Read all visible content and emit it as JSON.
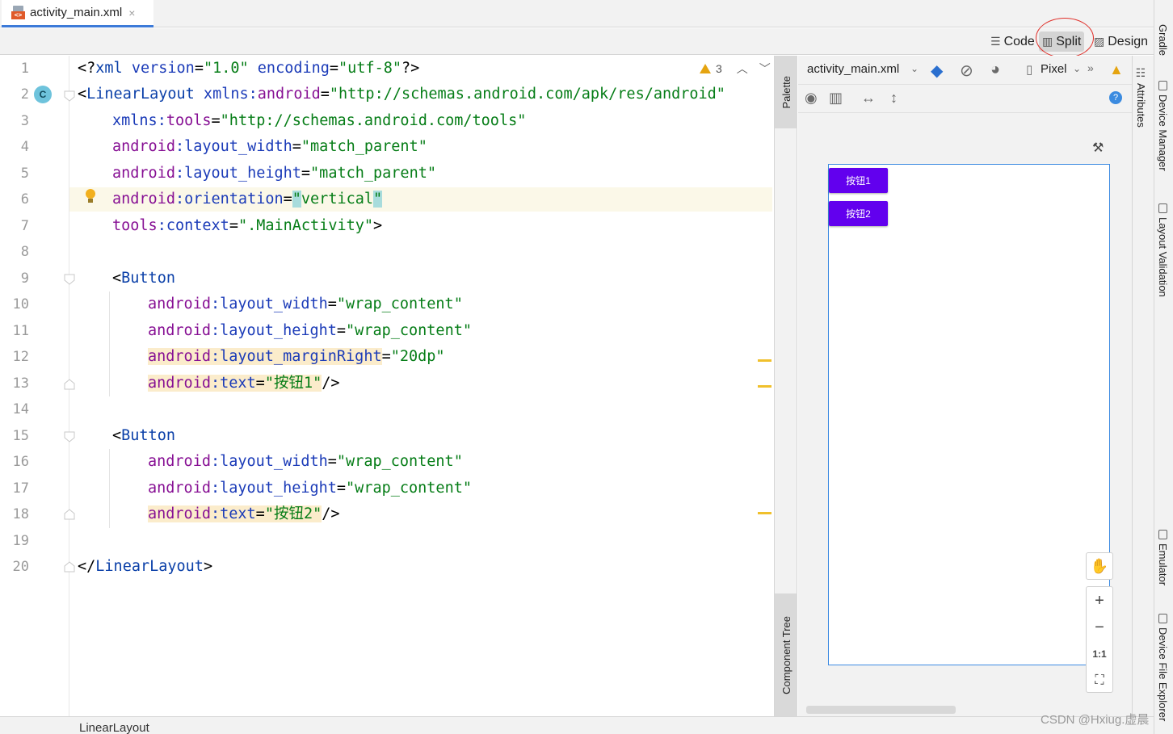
{
  "tab": {
    "filename": "activity_main.xml",
    "close": "×"
  },
  "modes": {
    "code": "Code",
    "split": "Split",
    "design": "Design"
  },
  "editor": {
    "warning_count": "3",
    "line_numbers": [
      "1",
      "2",
      "3",
      "4",
      "5",
      "6",
      "7",
      "8",
      "9",
      "10",
      "11",
      "12",
      "13",
      "14",
      "15",
      "16",
      "17",
      "18",
      "19",
      "20"
    ],
    "gutter_class_badge": "C",
    "lines": {
      "l1": {
        "a": "<?",
        "b": "xml",
        "c": " version",
        "d": "=",
        "e": "\"1.0\"",
        "f": " encoding",
        "g": "=",
        "h": "\"utf-8\"",
        "i": "?>"
      },
      "l2": {
        "a": "<",
        "b": "LinearLayout",
        "c": " xmlns:",
        "d": "android",
        "e": "=",
        "f": "\"http://schemas.android.com/apk/res/android\""
      },
      "l3": {
        "a": "xmlns:",
        "b": "tools",
        "c": "=",
        "d": "\"http://schemas.android.com/tools\""
      },
      "l4": {
        "a": "android",
        "b": ":layout_width",
        "c": "=",
        "d": "\"match_parent\""
      },
      "l5": {
        "a": "android",
        "b": ":layout_height",
        "c": "=",
        "d": "\"match_parent\""
      },
      "l6": {
        "a": "android",
        "b": ":orientation",
        "c": "=",
        "d": "\"",
        "e": "vertical",
        "f": "\""
      },
      "l7": {
        "a": "tools",
        "b": ":context",
        "c": "=",
        "d": "\".MainActivity\"",
        "e": ">"
      },
      "l9": {
        "a": "<",
        "b": "Button"
      },
      "l10": {
        "a": "android",
        "b": ":layout_width",
        "c": "=",
        "d": "\"wrap_content\""
      },
      "l11": {
        "a": "android",
        "b": ":layout_height",
        "c": "=",
        "d": "\"wrap_content\""
      },
      "l12": {
        "a": "android",
        "b": ":layout_marginRight",
        "c": "=",
        "d": "\"20dp\""
      },
      "l13": {
        "a": "android",
        "b": ":text",
        "c": "=",
        "d": "\"按钮1\"",
        "e": "/>"
      },
      "l15": {
        "a": "<",
        "b": "Button"
      },
      "l16": {
        "a": "android",
        "b": ":layout_width",
        "c": "=",
        "d": "\"wrap_content\""
      },
      "l17": {
        "a": "android",
        "b": ":layout_height",
        "c": "=",
        "d": "\"wrap_content\""
      },
      "l18": {
        "a": "android",
        "b": ":text",
        "c": "=",
        "d": "\"按钮2\"",
        "e": "/>"
      },
      "l20": {
        "a": "</",
        "b": "LinearLayout",
        "c": ">"
      }
    }
  },
  "side_tabs": {
    "palette": "Palette",
    "component_tree": "Component Tree",
    "attributes": "Attributes"
  },
  "preview": {
    "filename": "activity_main.xml",
    "device": "Pixel",
    "buttons": [
      "按钮1",
      "按钮2"
    ],
    "zoom_reset": "1:1"
  },
  "right_tools": [
    "Gradle",
    "Device Manager",
    "Layout Validation",
    "Emulator",
    "Device File Explorer"
  ],
  "status": {
    "breadcrumb": "LinearLayout"
  },
  "watermark": "CSDN @Hxiug.虚晨",
  "colors": {
    "accent": "#3c7ad8",
    "button_purple": "#6200ee",
    "warning": "#e5a410",
    "annotation_red": "#e0302a"
  }
}
